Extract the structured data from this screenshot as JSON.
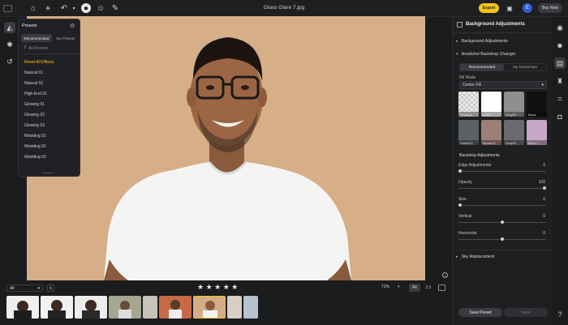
{
  "window": {
    "title": "Glass Glare 7.jpg"
  },
  "topbar": {
    "export_label": "Export",
    "buy_label": "Buy Now",
    "avatar_letter": "E"
  },
  "presets": {
    "title": "Presets",
    "tabs": [
      "Recommended",
      "My Presets"
    ],
    "filter_label": "All Presets",
    "reset_label": "Reset All Effects",
    "items": [
      "Natural 01",
      "Natural 02",
      "High-End 01",
      "Glowing 01",
      "Glowing 02",
      "Glowing 03",
      "Wedding 01",
      "Wedding 02",
      "Wedding 03"
    ]
  },
  "right_panel": {
    "header": "Background Adjustments",
    "section_bg": "Background Adjustments",
    "section_changer": "Headshot Backdrop Changer",
    "tabs": [
      "Recommended",
      "My backdrops"
    ],
    "fill_mode_label": "Fill Mode",
    "fill_mode_value": "Center Fill",
    "backdrops": [
      {
        "label": "Transpa...",
        "color": "#e9e9e9"
      },
      {
        "label": "White",
        "color": "#ffffff"
      },
      {
        "label": "Gray02",
        "color": "#8f8f8f"
      },
      {
        "label": "Black",
        "color": "#111111"
      },
      {
        "label": "Fabric02",
        "color": "#5b6266"
      },
      {
        "label": "Brown01",
        "color": "#9c7f76"
      },
      {
        "label": "Gray03",
        "color": "#6b6b6e"
      },
      {
        "label": "More >",
        "color": "#c9a7c7"
      }
    ],
    "backdrop_adj_label": "Backdrop Adjustments",
    "sliders": [
      {
        "label": "Edge Adjustments",
        "value": "0",
        "pos": 0.0
      },
      {
        "label": "Opacity",
        "value": "100",
        "pos": 1.0
      },
      {
        "label": "Size",
        "value": "0",
        "pos": 0.0
      },
      {
        "label": "Vertical",
        "value": "0",
        "pos": 0.5
      },
      {
        "label": "Horizontal",
        "value": "0",
        "pos": 0.5
      }
    ],
    "sky_label": "Sky Replacement",
    "save_preset": "Save Preset",
    "save": "Save"
  },
  "bottom": {
    "filter_value": "All",
    "zoom": "71%",
    "fit_label": "Fit",
    "one_to_one": "1:1",
    "stars": "★★★★★"
  },
  "colors": {
    "accent": "#f5c518",
    "photo_bg": "#d4ad87"
  }
}
